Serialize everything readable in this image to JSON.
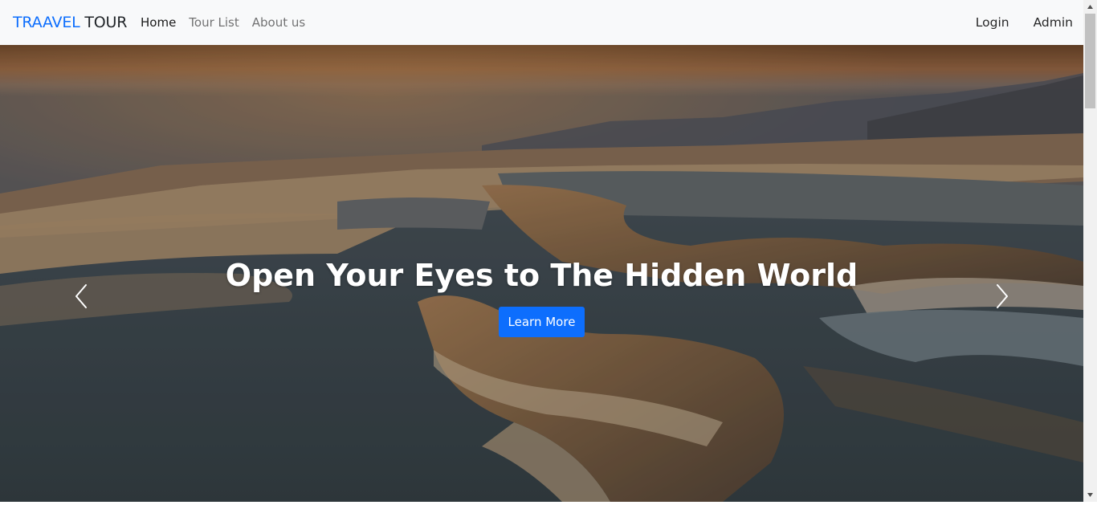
{
  "navbar": {
    "brand_part1": "TRAAVEL",
    "brand_part2": "TOUR",
    "brand_color": "#0d6efd",
    "links": [
      {
        "label": "Home",
        "active": true
      },
      {
        "label": "Tour List",
        "active": false
      },
      {
        "label": "About us",
        "active": false
      }
    ],
    "right_links": [
      {
        "label": "Login"
      },
      {
        "label": "Admin"
      }
    ]
  },
  "hero": {
    "title": "Open Your Eyes to The Hidden World",
    "button_label": "Learn More",
    "button_color": "#0d6efd",
    "prev_icon": "chevron-left-icon",
    "next_icon": "chevron-right-icon",
    "image_subject": "travertine terraces at sunset"
  },
  "scrollbar": {
    "up_icon": "scroll-up-arrow-icon",
    "down_icon": "scroll-down-arrow-icon"
  }
}
